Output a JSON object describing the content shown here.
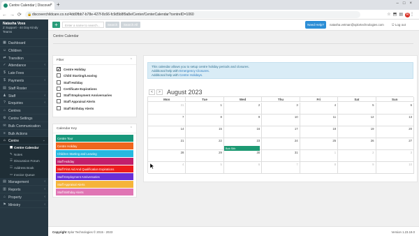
{
  "browser": {
    "tab_title": "Centre Calendar | Discover",
    "url": "discoverchildcare.co.nz/4dd0fbb7-b78e-427f-8c66-fc9d5b8f9a8e/Center/CenterCalendar?centreID=1060",
    "profile_initial": "R"
  },
  "sidebar": {
    "user_name": "Natasha Voss",
    "user_role": "Z Support - 44 Day Kindy Teams",
    "items": [
      {
        "label": "Dashboard",
        "icon": "dashboard-icon",
        "glyph": "▦"
      },
      {
        "label": "Children",
        "icon": "child-icon",
        "glyph": "☺"
      },
      {
        "label": "Transition",
        "icon": "transition-icon",
        "glyph": "⇄"
      },
      {
        "label": "Attendance",
        "icon": "attendance-icon",
        "glyph": "✓",
        "chevron": "‹"
      },
      {
        "label": "Late Fees",
        "icon": "late-fees-icon",
        "glyph": "$"
      },
      {
        "label": "Payments",
        "icon": "payments-icon",
        "glyph": "$",
        "chevron": "‹"
      },
      {
        "label": "Staff Roster",
        "icon": "roster-icon",
        "glyph": "▤"
      },
      {
        "label": "Staff",
        "icon": "staff-icon",
        "glyph": "♟",
        "chevron": "‹"
      },
      {
        "label": "Enquiries",
        "icon": "enquiries-icon",
        "glyph": "?",
        "chevron": "‹"
      },
      {
        "label": "Centres",
        "icon": "centres-icon",
        "glyph": "⌂"
      },
      {
        "label": "Centre Settings",
        "icon": "gear-icon",
        "glyph": "⚙"
      },
      {
        "label": "Bulk Communication",
        "icon": "communication-icon",
        "glyph": "✉"
      },
      {
        "label": "Bulk Actions",
        "icon": "bulk-actions-icon",
        "glyph": "≡"
      },
      {
        "label": "Centre",
        "icon": "centre-icon",
        "glyph": "⌂",
        "chevron": "⌄",
        "active": true
      }
    ],
    "subitems": [
      {
        "label": "Centre Calendar",
        "icon": "calendar-icon",
        "glyph": "▦",
        "active": true
      },
      {
        "label": "Notes",
        "icon": "notes-icon",
        "glyph": "✎"
      },
      {
        "label": "Discussion Forum",
        "icon": "forum-icon",
        "glyph": "☰"
      },
      {
        "label": "Address Book",
        "icon": "address-book-icon",
        "glyph": "☷"
      },
      {
        "label": "Invoice Queue",
        "icon": "invoice-icon",
        "glyph": "▭"
      }
    ],
    "bottom_items": [
      {
        "label": "Management",
        "icon": "management-icon",
        "glyph": "▤",
        "chevron": "‹"
      },
      {
        "label": "Reports",
        "icon": "reports-icon",
        "glyph": "▥",
        "chevron": "‹"
      },
      {
        "label": "Property",
        "icon": "property-icon",
        "glyph": "⌂",
        "chevron": "‹"
      },
      {
        "label": "Ministry",
        "icon": "ministry-icon",
        "glyph": "⚑",
        "chevron": "‹"
      }
    ]
  },
  "topbar": {
    "search_placeholder": "Enter a name to search...",
    "search_label": "Search",
    "search_all_label": "Search All",
    "need_help_label": "Need Help?",
    "user_email": "natasha.vetman@xplortechnologies.com",
    "logout_label": "Log out"
  },
  "page": {
    "title": "Centre Calendar"
  },
  "filter": {
    "title": "Filter",
    "items": [
      {
        "label": "Centre Holiday",
        "checked": true
      },
      {
        "label": "Child Starting/Leaving",
        "checked": false
      },
      {
        "label": "Staff Holiday",
        "checked": false
      },
      {
        "label": "Certificate Expirations",
        "checked": false
      },
      {
        "label": "Staff Employment Anniversaries",
        "checked": false
      },
      {
        "label": "Staff Appraisal Alerts",
        "checked": false
      },
      {
        "label": "Staff Birthday Alerts",
        "checked": false
      }
    ]
  },
  "calendar_key": {
    "title": "Calendar Key",
    "items": [
      {
        "label": "Centre Tour",
        "color": "#17977b"
      },
      {
        "label": "Centre Holiday",
        "color": "#f0661e"
      },
      {
        "label": "Children Starting and Leaving",
        "color": "#26b8e0"
      },
      {
        "label": "Staff Holiday",
        "color": "#c21f6b"
      },
      {
        "label": "Staff First Aid And Qualification Expirations",
        "color": "#ee1c1c"
      },
      {
        "label": "Staff Employment Anniversaries",
        "color": "#6a2fd6"
      },
      {
        "label": "Staff Appraisal Alerts",
        "color": "#f5b43a"
      },
      {
        "label": "Staff Birthday Alerts",
        "color": "#e075b4"
      }
    ]
  },
  "calendar": {
    "info_line1": "This calendar allows you to setup centre holiday periods and closures.",
    "info_line2_prefix": "Additional help with ",
    "info_line2_link": "Emergency Closures",
    "info_line3_prefix": "Additional help with ",
    "info_line3_link": "Centre Holidays",
    "prev_label": "<",
    "next_label": ">",
    "month_label": "August 2023",
    "day_headers": [
      "Mon",
      "Tue",
      "Wed",
      "Thu",
      "Fri",
      "Sat",
      "Sun"
    ],
    "weeks": [
      [
        "31",
        "1",
        "2",
        "3",
        "4",
        "5",
        "6"
      ],
      [
        "7",
        "8",
        "9",
        "10",
        "11",
        "12",
        "13"
      ],
      [
        "14",
        "15",
        "16",
        "17",
        "18",
        "19",
        "20"
      ],
      [
        "21",
        "22",
        "23",
        "24",
        "25",
        "26",
        "27"
      ],
      [
        "28",
        "29",
        "30",
        "31",
        "1",
        "2",
        "3"
      ],
      [
        "4",
        "5",
        "6",
        "7",
        "8",
        "9",
        "10"
      ]
    ],
    "other_month": [
      [
        0
      ],
      [],
      [],
      [],
      [
        4,
        5,
        6
      ],
      [
        0,
        1,
        2,
        3,
        4,
        5,
        6
      ]
    ],
    "event": {
      "label": "Bob Sith",
      "color": "#1d9a73"
    }
  },
  "footer": {
    "copyright_prefix": "Copyright",
    "copyright_text": "Xplor Technologies © 2015 - 2023",
    "version": "Version 1.23.19.0"
  }
}
